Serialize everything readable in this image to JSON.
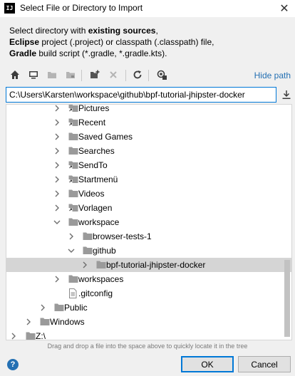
{
  "window": {
    "app_icon": "IJ",
    "title": "Select File or Directory to Import",
    "close": "✕"
  },
  "description": {
    "line1_prefix": "Select directory with ",
    "line1_bold": "existing sources",
    "line1_suffix": ",",
    "line2_bold": "Eclipse",
    "line2_rest": " project (.project) or classpath (.classpath) file,",
    "line3_bold": "Gradle",
    "line3_rest": " build script (*.gradle, *.gradle.kts)."
  },
  "toolbar": {
    "icons": [
      "home-icon",
      "desktop-icon",
      "project-folder-icon",
      "module-folder-icon",
      "new-folder-icon",
      "delete-icon",
      "refresh-icon",
      "show-hidden-icon"
    ],
    "hide_path": "Hide path"
  },
  "path": {
    "value": "C:\\Users\\Karsten\\workspace\\github\\bpf-tutorial-jhipster-docker"
  },
  "tree": {
    "rows": [
      {
        "label": "Pictures"
      },
      {
        "label": "Recent"
      },
      {
        "label": "Saved Games"
      },
      {
        "label": "Searches"
      },
      {
        "label": "SendTo"
      },
      {
        "label": "Startmenü"
      },
      {
        "label": "Videos"
      },
      {
        "label": "Vorlagen"
      },
      {
        "label": "workspace"
      },
      {
        "label": "browser-tests-1"
      },
      {
        "label": "github"
      },
      {
        "label": "bpf-tutorial-jhipster-docker"
      },
      {
        "label": "workspaces"
      },
      {
        "label": ".gitconfig"
      },
      {
        "label": "Public"
      },
      {
        "label": "Windows"
      },
      {
        "label": "Z:\\"
      }
    ]
  },
  "hint": "Drag and drop a file into the space above to quickly locate it in the tree",
  "buttons": {
    "help": "?",
    "ok": "OK",
    "cancel": "Cancel"
  },
  "colors": {
    "accent": "#0078d7",
    "link": "#2470b3",
    "selection": "#d5d5d5",
    "folder": "#9a9a9a"
  }
}
